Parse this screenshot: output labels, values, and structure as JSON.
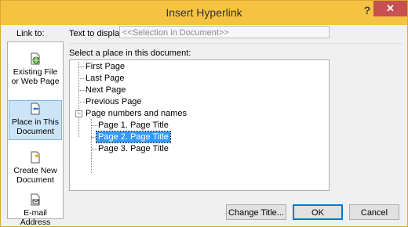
{
  "window": {
    "title": "Insert Hyperlink",
    "help_label": "?",
    "close_label": "✕"
  },
  "link_to": {
    "label": "Link to:",
    "items": [
      {
        "label_line1": "Existing File",
        "label_line2": "or Web Page",
        "icon": "globe-page-icon",
        "selected": false
      },
      {
        "label_line1": "Place in This",
        "label_line2": "Document",
        "icon": "document-place-icon",
        "selected": true
      },
      {
        "label_line1": "Create New",
        "label_line2": "Document",
        "icon": "new-document-icon",
        "selected": false
      },
      {
        "label_line1": "E-mail",
        "label_line2": "Address",
        "icon": "email-icon",
        "selected": false
      }
    ]
  },
  "text_to_display": {
    "label": "Text to display:",
    "value": "<<Selection in Document>>"
  },
  "place_tree": {
    "label": "Select a place in this document:",
    "items": [
      {
        "label": "First Page"
      },
      {
        "label": "Last Page"
      },
      {
        "label": "Next Page"
      },
      {
        "label": "Previous Page"
      },
      {
        "label": "Page numbers and names",
        "expanded": true
      },
      {
        "label": "Page 1. Page Title"
      },
      {
        "label": "Page 2. Page Title",
        "selected": true
      },
      {
        "label": "Page 3. Page Title"
      }
    ],
    "expander_symbol": "−"
  },
  "buttons": {
    "change_title": "Change Title...",
    "ok": "OK",
    "cancel": "Cancel"
  }
}
